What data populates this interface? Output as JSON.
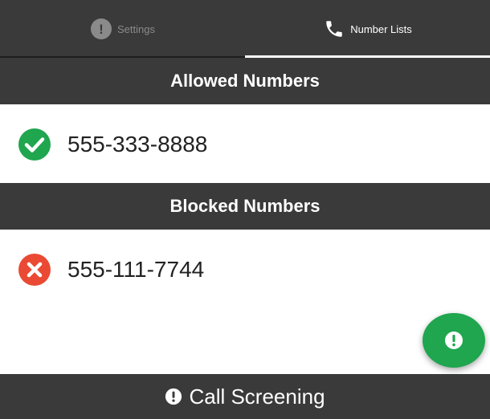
{
  "tabs": [
    {
      "label": "Settings",
      "icon": "alert-circle-icon",
      "active": false
    },
    {
      "label": "Number Lists",
      "icon": "phone-icon",
      "active": true
    }
  ],
  "allowed": {
    "header": "Allowed Numbers",
    "items": [
      {
        "number": "555-333-8888",
        "status": "allowed",
        "icon": "check-circle-icon"
      }
    ]
  },
  "blocked": {
    "header": "Blocked Numbers",
    "items": [
      {
        "number": "555-111-7744",
        "status": "blocked",
        "icon": "x-circle-icon"
      }
    ]
  },
  "fab": {
    "icon": "alert-icon"
  },
  "bottom_bar": {
    "label": "Call Screening",
    "icon": "alert-circle-icon"
  },
  "colors": {
    "bar_bg": "#3a3a3a",
    "allowed_green": "#1fa64f",
    "blocked_red": "#ea4a34",
    "fab_green": "#1fa64f",
    "inactive_tab_text": "#8a8a8a"
  }
}
